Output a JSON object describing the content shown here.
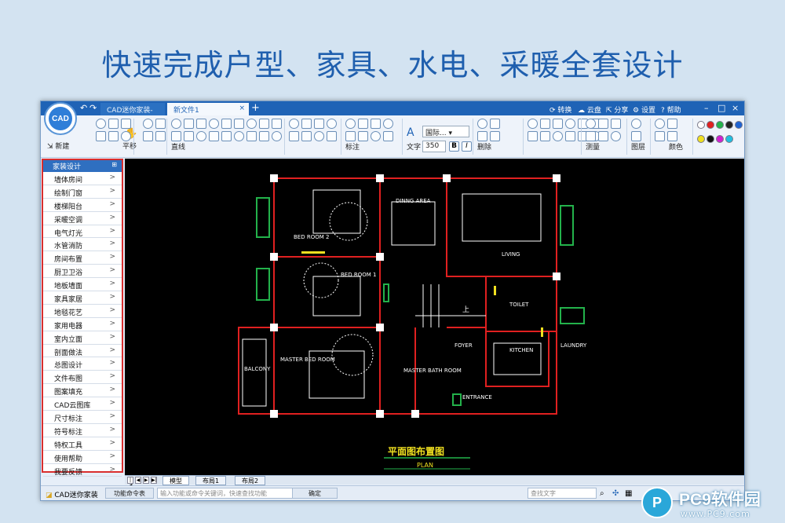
{
  "headline": "快速完成户型、家具、水电、采暖全套设计",
  "app": {
    "logo_text": "CAD",
    "tabs": [
      {
        "label": "CAD迷你家装-首页"
      },
      {
        "label": "新文件1"
      }
    ],
    "top_menu": {
      "convert": "转换",
      "cloud": "云盘",
      "share": "分享",
      "settings": "设置",
      "help": "帮助"
    }
  },
  "toolbar": {
    "new_label": "新建",
    "pan_label": "平移",
    "line_label": "直线",
    "dim_label": "标注",
    "text_label": "文字",
    "delete_label": "删除",
    "measure_label": "测量",
    "layer_label": "图层",
    "color_label": "颜色",
    "font_name": "国际...",
    "text_height": "350",
    "bold": "B",
    "italic": "I",
    "palette": [
      "#ffffff",
      "#e02020",
      "#23b24b",
      "#222222",
      "#1e63d3",
      "#f0e020",
      "#111111",
      "#d020d0",
      "#20c0e0"
    ]
  },
  "sidebar": {
    "header": "家装设计",
    "items": [
      "墙体房间",
      "绘制门窗",
      "楼梯阳台",
      "采暖空调",
      "电气灯光",
      "水管消防",
      "房间布置",
      "厨卫卫浴",
      "地板墙面",
      "家具家居",
      "地毯花艺",
      "家用电器",
      "室内立面",
      "剖面做法",
      "总图设计",
      "文件布图",
      "图案填充",
      "CAD云图库",
      "尺寸标注",
      "符号标注",
      "特权工具",
      "使用帮助",
      "我要反馈"
    ]
  },
  "drawing": {
    "rooms": [
      "DINNG AREA",
      "BED ROOM 2",
      "LIVING",
      "BED ROOM 1",
      "TOILET",
      "FOYER",
      "KITCHEN",
      "LAUNDRY",
      "BALCONY",
      "MASTER BED ROOM",
      "MASTER BATH ROOM",
      "ENTRANCE"
    ],
    "stair_label": "上",
    "plan_title": "平面图布置图",
    "plan_subtitle": "PLAN"
  },
  "layout_tabs": [
    "模型",
    "布局1",
    "布局2"
  ],
  "status_bar": {
    "app_name": "CAD迷你家装",
    "mode_button": "功能命令表",
    "command_placeholder": "输入功能或命令关键词，快速查找功能",
    "confirm_button": "确定",
    "find_text_placeholder": "查找文字"
  },
  "watermark": {
    "badge": "P",
    "title": "PC9软件园",
    "url": "www.PC9.com"
  }
}
